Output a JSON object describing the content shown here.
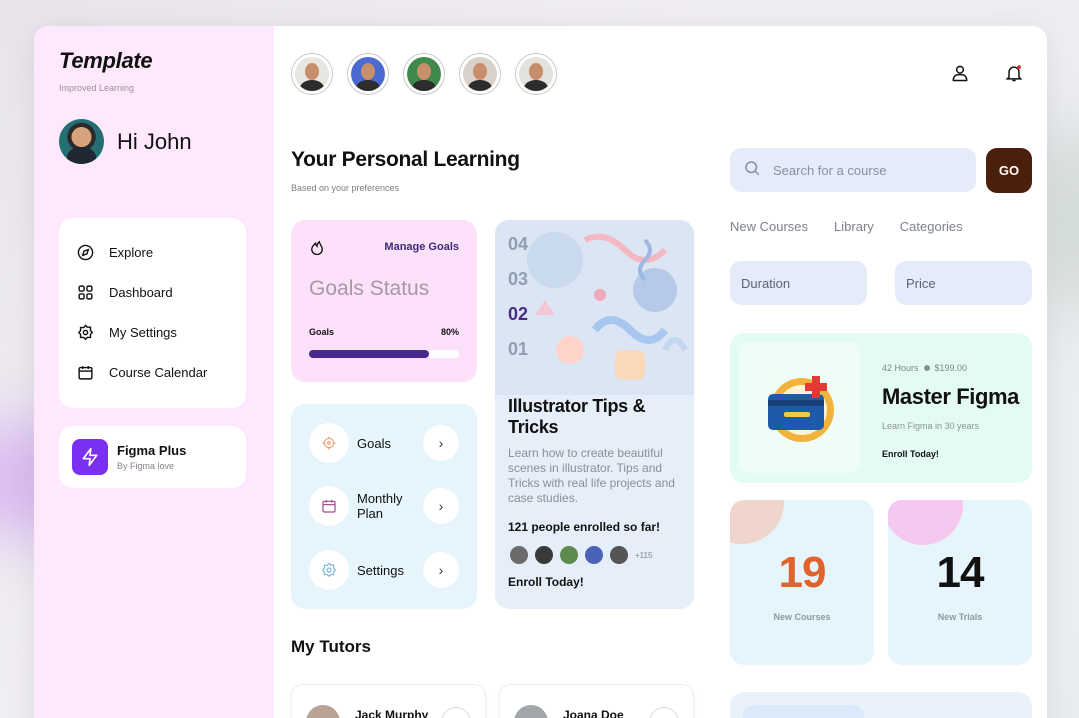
{
  "brand": {
    "name": "Template",
    "tagline": "Improved Learning"
  },
  "user": {
    "greeting": "Hi John"
  },
  "sidebar": {
    "items": [
      {
        "label": "Explore",
        "icon": "compass-icon"
      },
      {
        "label": "Dashboard",
        "icon": "grid-icon"
      },
      {
        "label": "My Settings",
        "icon": "gear-icon"
      },
      {
        "label": "Course Calendar",
        "icon": "calendar-icon"
      }
    ],
    "promo": {
      "title": "Figma Plus",
      "subtitle": "By Figma love",
      "icon": "lightning-icon"
    }
  },
  "main": {
    "title": "Your Personal Learning",
    "subtitle": "Based on your preferences"
  },
  "goals": {
    "manage_label": "Manage Goals",
    "status_label": "Goals Status",
    "progress_label": "Goals",
    "progress_text": "80%",
    "progress_value": 0.8
  },
  "quick_menu": [
    {
      "label": "Goals",
      "icon": "target-icon"
    },
    {
      "label": "Monthly Plan",
      "icon": "calendar-icon"
    },
    {
      "label": "Settings",
      "icon": "gear-icon"
    }
  ],
  "featured": {
    "numbers": [
      "04",
      "03",
      "02",
      "01"
    ],
    "active_number": "02",
    "title": "Illustrator Tips & Tricks",
    "description": "Learn how to create beautiful scenes in illustrator. Tips and Tricks with real life projects and case studies.",
    "enrolled_text": "121 people enrolled so far!",
    "more_count": "+115",
    "cta": "Enroll Today!"
  },
  "tutors": {
    "heading": "My Tutors",
    "items": [
      {
        "name": "Jack Murphy"
      },
      {
        "name": "Joana Doe"
      }
    ]
  },
  "search": {
    "placeholder": "Search for a course",
    "button": "GO"
  },
  "tabs": [
    "New Courses",
    "Library",
    "Categories"
  ],
  "filters": {
    "duration": "Duration",
    "price": "Price"
  },
  "course": {
    "hours": "42 Hours",
    "price": "$199.00",
    "title": "Master Figma",
    "subtitle": "Learn Figma in 30 years",
    "cta": "Enroll Today!"
  },
  "stats": [
    {
      "value": "19",
      "label": "New Courses",
      "color": "#e0622c"
    },
    {
      "value": "14",
      "label": "New Trials",
      "color": "#111111"
    }
  ],
  "colors": {
    "accent": "#47288f",
    "go_button": "#4a1f0c",
    "promo_icon": "#7b2ff2",
    "notification_dot": "#e53935"
  }
}
